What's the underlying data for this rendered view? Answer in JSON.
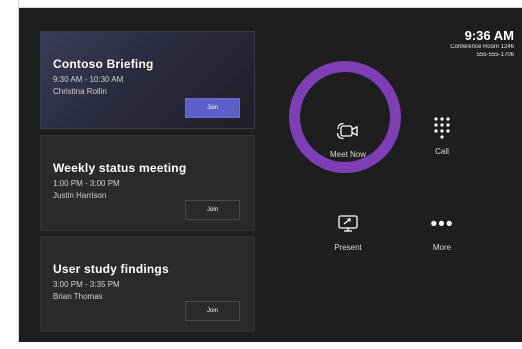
{
  "clock": {
    "time": "9:36 AM",
    "room": "Conference Room 1246",
    "phone": "555-555-1706"
  },
  "meetings": [
    {
      "title": "Contoso Briefing",
      "time": "9:30 AM - 10:30 AM",
      "organizer": "Christina Rollin",
      "join_label": "Join"
    },
    {
      "title": "Weekly status meeting",
      "time": "1:00 PM - 3:00 PM",
      "organizer": "Justin Harrison",
      "join_label": "Join"
    },
    {
      "title": "User study findings",
      "time": "3:00 PM - 3:35 PM",
      "organizer": "Brian Thomas",
      "join_label": "Join"
    }
  ],
  "actions": {
    "meet_now": {
      "label": "Meet Now",
      "icon": "video-camera-icon"
    },
    "call": {
      "label": "Call",
      "icon": "dialpad-icon"
    },
    "present": {
      "label": "Present",
      "icon": "present-screen-icon"
    },
    "more": {
      "label": "More",
      "icon": "more-icon"
    }
  },
  "colors": {
    "accent": "#7e3fb6",
    "join_primary": "#5b5fc7",
    "background": "#1e1e1e",
    "card": "#2a2a2a"
  }
}
